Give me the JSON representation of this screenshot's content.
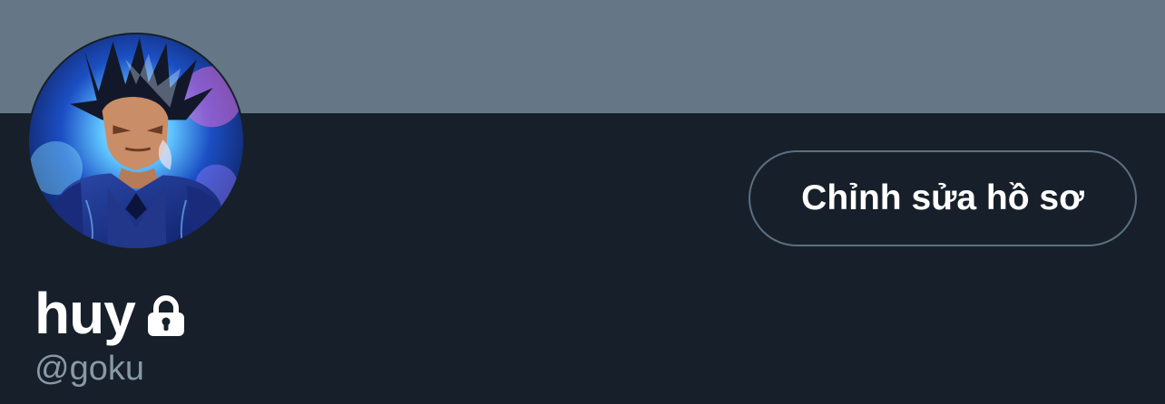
{
  "profile": {
    "display_name": "huy",
    "handle": "@goku",
    "protected_icon": "lock-icon",
    "avatar_icon": "profile-avatar"
  },
  "actions": {
    "edit_profile_label": "Chỉnh sửa hồ sơ"
  },
  "colors": {
    "banner": "#657786",
    "background": "#17202a",
    "text_primary": "#ffffff",
    "text_secondary": "#8899a6",
    "button_border": "#5b6f82"
  }
}
